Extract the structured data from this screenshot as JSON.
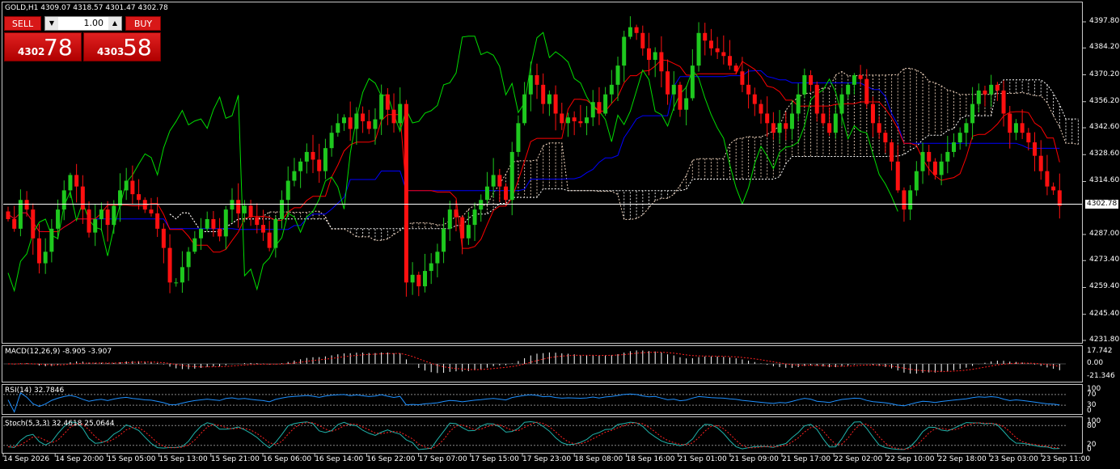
{
  "symbol_header": "GOLD,H1  4309.07 4318.57 4301.47 4302.78",
  "trade": {
    "sell_label": "SELL",
    "buy_label": "BUY",
    "lot_value": "1.00",
    "down_arrow": "▼",
    "up_arrow": "▲",
    "bid_small": "4302",
    "bid_large": "78",
    "ask_small": "4303",
    "ask_large": "58"
  },
  "current_price": "4302.78",
  "price_axis": [
    "4397.80",
    "4384.20",
    "4370.20",
    "4356.20",
    "4342.60",
    "4328.60",
    "4314.60",
    "4287.00",
    "4273.40",
    "4259.40",
    "4245.40",
    "4231.80"
  ],
  "time_axis": [
    "14 Sep 2026",
    "14 Sep 20:00",
    "15 Sep 05:00",
    "15 Sep 13:00",
    "15 Sep 21:00",
    "16 Sep 06:00",
    "16 Sep 14:00",
    "16 Sep 22:00",
    "17 Sep 07:00",
    "17 Sep 15:00",
    "17 Sep 23:00",
    "18 Sep 08:00",
    "18 Sep 16:00",
    "21 Sep 01:00",
    "21 Sep 09:00",
    "21 Sep 17:00",
    "22 Sep 02:00",
    "22 Sep 10:00",
    "22 Sep 18:00",
    "23 Sep 03:00",
    "23 Sep 11:00"
  ],
  "macd": {
    "label": "MACD(12,26,9) -8.905 -3.907",
    "axis": [
      "17.742",
      "0.00",
      "-21.346"
    ]
  },
  "rsi": {
    "label": "RSI(14) 32.7846",
    "axis": [
      "100",
      "70",
      "30",
      "0"
    ]
  },
  "stoch": {
    "label": "Stoch(5,3,3) 32.4618 25.0644",
    "axis": [
      "100",
      "80",
      "20",
      "0"
    ]
  },
  "colors": {
    "bull": "#1ec81e",
    "bear": "#ff1010",
    "kijun": "#0000ff",
    "tenkan": "#ff0000",
    "chikou": "#00dd00",
    "rsi": "#1e90ff"
  },
  "chart_data": {
    "type": "candlestick",
    "title": "GOLD,H1",
    "ylim": [
      4231.8,
      4404
    ],
    "closes": [
      4295,
      4290,
      4305,
      4300,
      4285,
      4272,
      4278,
      4290,
      4300,
      4310,
      4318,
      4312,
      4300,
      4288,
      4295,
      4300,
      4292,
      4302,
      4310,
      4315,
      4308,
      4305,
      4300,
      4298,
      4290,
      4280,
      4262,
      4262,
      4270,
      4278,
      4285,
      4290,
      4295,
      4290,
      4286,
      4300,
      4305,
      4298,
      4302,
      4296,
      4292,
      4288,
      4280,
      4295,
      4305,
      4315,
      4320,
      4325,
      4330,
      4326,
      4320,
      4332,
      4340,
      4345,
      4348,
      4342,
      4350,
      4346,
      4342,
      4347,
      4360,
      4352,
      4345,
      4355,
      4262,
      4266,
      4260,
      4268,
      4272,
      4278,
      4290,
      4300,
      4296,
      4285,
      4292,
      4300,
      4305,
      4312,
      4318,
      4312,
      4305,
      4330,
      4345,
      4360,
      4370,
      4365,
      4355,
      4360,
      4350,
      4345,
      4348,
      4346,
      4345,
      4348,
      4356,
      4350,
      4360,
      4365,
      4375,
      4390,
      4395,
      4392,
      4384,
      4378,
      4382,
      4372,
      4360,
      4365,
      4352,
      4358,
      4375,
      4392,
      4388,
      4384,
      4382,
      4380,
      4375,
      4372,
      4365,
      4360,
      4355,
      4350,
      4345,
      4340,
      4345,
      4342,
      4350,
      4360,
      4370,
      4365,
      4350,
      4345,
      4340,
      4350,
      4360,
      4365,
      4370,
      4368,
      4355,
      4345,
      4340,
      4335,
      4325,
      4310,
      4300,
      4310,
      4320,
      4330,
      4325,
      4318,
      4325,
      4330,
      4335,
      4340,
      4345,
      4355,
      4362,
      4360,
      4365,
      4362,
      4350,
      4340,
      4345,
      4340,
      4335,
      4328,
      4320,
      4312,
      4310,
      4302
    ]
  }
}
